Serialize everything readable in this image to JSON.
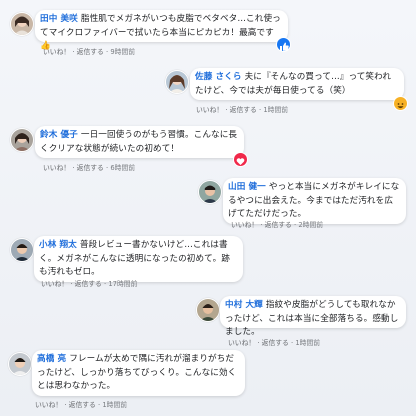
{
  "comments": [
    {
      "name": "田中 美咲",
      "text": "脂性肌でメガネがいつも皮脂でベタベタ…これ使ってマイクロファイバーで拭いたら本当にピカピカ！最高です👍",
      "like": "いいね！",
      "reply": "返信する",
      "time": "9時間前",
      "reaction": "like-icon",
      "reaction_color": "#1877f2"
    },
    {
      "name": "佐藤 さくら",
      "text": "夫に『そんなの買って…』って笑われたけど、今では夫が毎日使ってる（笑）",
      "like": "いいね！",
      "reply": "返信する",
      "time": "1時間前",
      "reaction": "haha-icon",
      "reaction_color": "#f7b125"
    },
    {
      "name": "鈴木 優子",
      "text": "一日一回使うのがもう習慣。こんなに長くクリアな状態が続いたの初めて！",
      "like": "いいね！",
      "reply": "返信する",
      "time": "6時間前",
      "reaction": "love-icon",
      "reaction_color": "#f0284a"
    },
    {
      "name": "山田 健一",
      "text": "やっと本当にメガネがキレイになるやつに出会えた。今まではただ汚れを広げてただけだった。",
      "like": "いいね！",
      "reply": "返信する",
      "time": "2時間前",
      "reaction": "",
      "reaction_color": ""
    },
    {
      "name": "小林 翔太",
      "text": "普段レビュー書かないけど…これは書く。メガネがこんなに透明になったの初めて。跡も汚れもゼロ。",
      "like": "いいね！",
      "reply": "返信する",
      "time": "17時間前",
      "reaction": "",
      "reaction_color": ""
    },
    {
      "name": "中村 大輝",
      "text": "指紋や皮脂がどうしても取れなかったけど、これは本当に全部落ちる。感動しました。",
      "like": "いいね！",
      "reply": "返信する",
      "time": "1時間前",
      "reaction": "",
      "reaction_color": ""
    },
    {
      "name": "高橋 亮",
      "text": "フレームが太めで隅に汚れが溜まりがちだったけど、しっかり落ちてびっくり。こんなに効くとは思わなかった。",
      "like": "いいね！",
      "reply": "返信する",
      "time": "1時間前",
      "reaction": "",
      "reaction_color": ""
    }
  ]
}
